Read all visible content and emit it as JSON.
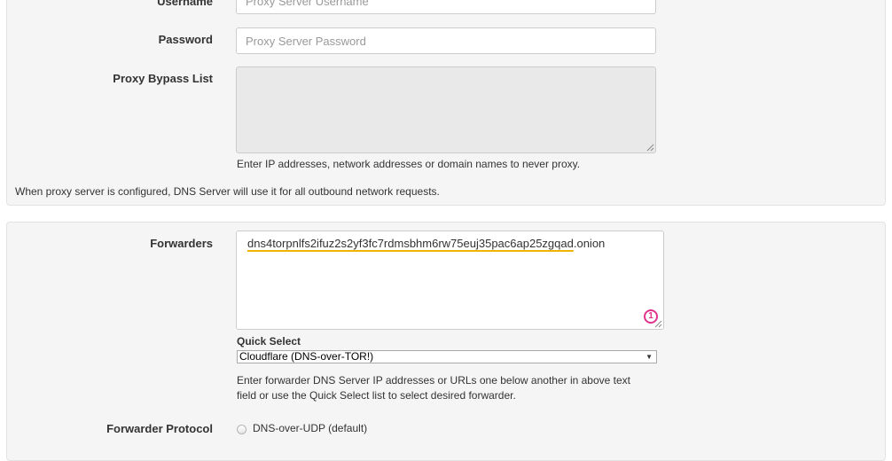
{
  "proxy": {
    "username_label": "Username",
    "username_placeholder": "Proxy Server Username",
    "password_label": "Password",
    "password_placeholder": "Proxy Server Password",
    "bypass_label": "Proxy Bypass List",
    "bypass_help": "Enter IP addresses, network addresses or domain names to never proxy.",
    "note": "When proxy server is configured, DNS Server will use it for all outbound network requests."
  },
  "forwarders": {
    "label": "Forwarders",
    "value_misspelled": "dns4torpnlfs2ifuz2s2yf3fc7rdmsbhm6rw75euj35pac6ap25zgqad",
    "value_suffix": ".onion",
    "spellcheck_badge": "1",
    "quick_select_label": "Quick Select",
    "quick_select_value": "Cloudflare (DNS-over-TOR!)",
    "help_line1": "Enter forwarder DNS Server IP addresses or URLs one below another in above text",
    "help_line2": "field or use the Quick Select list to select desired forwarder.",
    "protocol_label": "Forwarder Protocol",
    "protocol_option_udp": "DNS-over-UDP (default)"
  },
  "colors": {
    "panel_bg": "#f5f5f5",
    "spellcheck_underline": "#f0b400",
    "badge": "#e0338c"
  }
}
